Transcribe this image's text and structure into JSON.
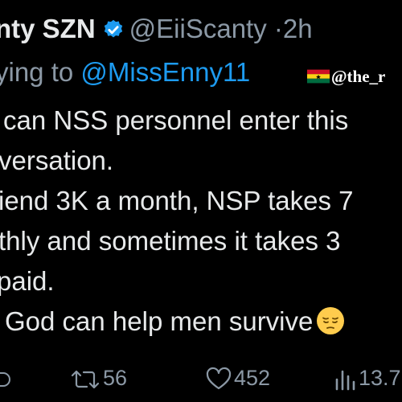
{
  "tweet": {
    "display_name": "nty SZN",
    "handle": "@EiiScanty",
    "separator": "·",
    "time": "2h",
    "reply_prefix": "ying to",
    "reply_to": "@MissEnny11",
    "watermark": "@the_r",
    "body_lines": [
      "can NSS personnel enter this",
      "versation.",
      "iend 3K a month, NSP takes 7",
      "thly and sometimes it takes 3",
      "paid.",
      "God can help men survive"
    ],
    "emoji_name": "pensive-face-icon"
  },
  "actions": {
    "retweets": "56",
    "likes": "452",
    "views": "13.7"
  },
  "colors": {
    "background": "#000000",
    "text": "#e7e9ea",
    "secondary": "#8b98a5",
    "link": "#1d9bf0",
    "verified": "#1d9bf0"
  }
}
